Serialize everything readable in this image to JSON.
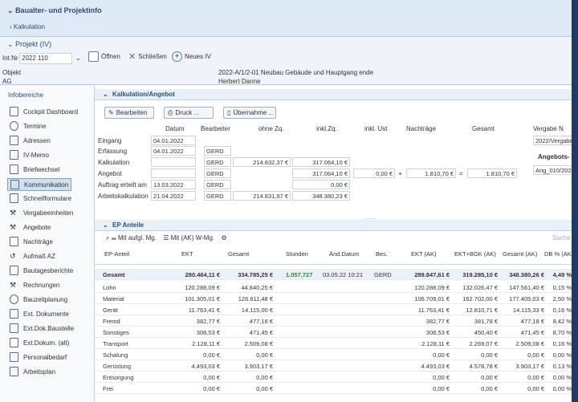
{
  "top": {
    "section1": "Baualter- und Projektinfo",
    "kalkulation_link": "Kalkulation",
    "projekt_title": "Projekt (IV)"
  },
  "proj": {
    "int_nr_label": "Int.Nr",
    "int_nr_value": "2022 110",
    "btn_oeffnen": "Öffnen",
    "btn_schliessen": "Schließen",
    "btn_neues": "Neues IV",
    "objekt_label": "Objekt",
    "ag_label": "AG",
    "objekt_value": "2022-A/1/2-01 Neubau Gebäude und Hauptgang ende",
    "ag_value": "Herbert Danne"
  },
  "sidebar": {
    "header": "Infobereiche",
    "items": [
      "Cockpit Dashboard",
      "Termine",
      "Adressen",
      "IV-Memo",
      "Briefwechsel",
      "Kommunikation",
      "Schnellformulare",
      "Vergabeeinheiten",
      "Angebote",
      "Nachträge",
      "Aufmaß AZ",
      "Bautagesberichte",
      "Rechnungen",
      "Bauzeitplanung",
      "Ext. Dokumente",
      "Ext.Dok.Baustelle",
      "Ext.Dokum. (alt)",
      "Personalbedarf",
      "Arbeitsplan"
    ]
  },
  "kalk": {
    "title": "Kalkulation/Angebot",
    "btn_bearbeiten": "Bearbeiten",
    "btn_druck": "Druck ...",
    "btn_uebernahme": "Übernahme ...",
    "col_datum": "Datum",
    "col_bearbeiter": "Bearbeiter",
    "col_ohne": "ohne Zq.",
    "col_inkl": "inkl.Zq.",
    "col_inkl_ust": "inkl. Ust",
    "col_nachtraege": "Nachträge",
    "col_gesamt": "Gesamt",
    "col_vergabe": "Vergabe N",
    "vergabe_value": "2022/Vergabe",
    "angebot_label": "Angebots-",
    "angebot_value": "Ang_010/2022",
    "rows": [
      {
        "label": "Eingang",
        "datum": "04.01.2022",
        "bearb": "",
        "ohne": "",
        "inkl": ""
      },
      {
        "label": "Erfassung",
        "datum": "04.01.2022",
        "bearb": "GERD",
        "ohne": "",
        "inkl": ""
      },
      {
        "label": "Kalkulation",
        "datum": "",
        "bearb": "GERD",
        "ohne": "214.832,37 €",
        "inkl": "317.064,10 €"
      },
      {
        "label": "Angebot",
        "datum": "",
        "bearb": "GERD",
        "ohne": "",
        "inkl": "317.064,10 €"
      },
      {
        "label": "Auftrag erteilt am",
        "datum": "13.03.2022",
        "bearb": "GERD",
        "ohne": "",
        "inkl": "0,00 €"
      },
      {
        "label": "Arbeitskalkulation",
        "datum": "21.04.2022",
        "bearb": "GERD",
        "ohne": "214.831,97 €",
        "inkl": "348.380,23 €"
      }
    ],
    "ust_value": "0,00 €",
    "nachtraege_value": "1.810,70 €",
    "gesamt_value": "1.810,70 €"
  },
  "ep": {
    "title": "EP Anteile",
    "opt1": "Mit aufgl. Mg.",
    "opt2": "Mit (AK) W-Mg.",
    "search": "Suche",
    "headers": [
      "EP-Anteil",
      "EKT",
      "Gesamt",
      "Stunden",
      "Änd.Datum",
      "Bes.",
      "EKT (AK)",
      "EKT+BGK (AK)",
      "Gesamt (AK)",
      "DB % (AK)"
    ],
    "rows": [
      [
        "Gesamt",
        "280.464,11 €",
        "334.785,25 €",
        "1.057,727",
        "03.05.22 10:21",
        "GERD",
        "289.847,61 €",
        "319.285,10 €",
        "348.380,26 €",
        "4,49 %"
      ],
      [
        "Lohn",
        "120.288,09 €",
        "44.840,25 €",
        "",
        "",
        "",
        "120.288,09 €",
        "132.026,47 €",
        "147.561,40 €",
        "0,15 %"
      ],
      [
        "Material",
        "101.305,01 €",
        "126.611,48 €",
        "",
        "",
        "",
        "106.709,01 €",
        "162.702,00 €",
        "177.405,03 €",
        "2,50 %"
      ],
      [
        "Gerät",
        "11.763,41 €",
        "14.115,00 €",
        "",
        "",
        "",
        "11.763,41 €",
        "12.810,71 €",
        "14.115,33 €",
        "0,16 %"
      ],
      [
        "Fremd",
        "382,77 €",
        "477,16 €",
        "",
        "",
        "",
        "382,77 €",
        "381,78 €",
        "477,18 €",
        "8,42 %"
      ],
      [
        "Sonstiges",
        "308,53 €",
        "471,45 €",
        "",
        "",
        "",
        "308,53 €",
        "450,40 €",
        "471,45 €",
        "8,70 %"
      ],
      [
        "Transport",
        "2.128,11 €",
        "2.509,08 €",
        "",
        "",
        "",
        "2.128,11 €",
        "2.269,07 €",
        "2.509,08 €",
        "0,16 %"
      ],
      [
        "Schalung",
        "0,00 €",
        "0,00 €",
        "",
        "",
        "",
        "0,00 €",
        "0,00 €",
        "0,00 €",
        "0,00 %"
      ],
      [
        "Gerüstung",
        "4.493,03 €",
        "3.903,17 €",
        "",
        "",
        "",
        "4.493,03 €",
        "4.578,78 €",
        "3.903,17 €",
        "0,13 %"
      ],
      [
        "Entsorgung",
        "0,00 €",
        "0,00 €",
        "",
        "",
        "",
        "0,00 €",
        "0,00 €",
        "0,00 €",
        "0,00 %"
      ],
      [
        "Frei",
        "0,00 €",
        "0,00 €",
        "",
        "",
        "",
        "0,00 €",
        "0,00 €",
        "0,00 €",
        "0,00 %"
      ]
    ]
  },
  "colors": {
    "accent": "#2a4e7a",
    "header_bg": "#dde9f4",
    "frame": "#1e3a66"
  }
}
